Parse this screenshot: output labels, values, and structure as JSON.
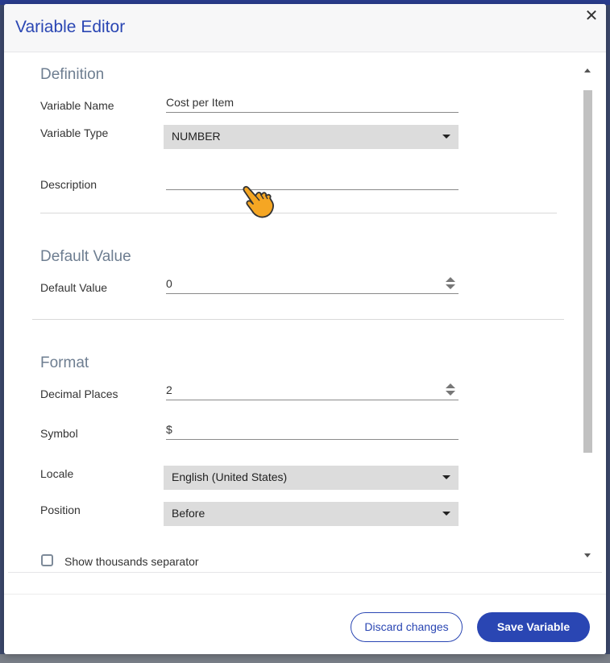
{
  "dialog": {
    "title": "Variable Editor",
    "close_glyph": "✕"
  },
  "definition": {
    "section_title": "Definition",
    "variable_name_label": "Variable Name",
    "variable_name_value": "Cost per Item",
    "variable_type_label": "Variable Type",
    "variable_type_value": "NUMBER",
    "description_label": "Description",
    "description_value": ""
  },
  "default_value": {
    "section_title": "Default Value",
    "label": "Default Value",
    "value": "0"
  },
  "format": {
    "section_title": "Format",
    "decimal_places_label": "Decimal Places",
    "decimal_places_value": "2",
    "symbol_label": "Symbol",
    "symbol_value": "$",
    "locale_label": "Locale",
    "locale_value": "English (United States)",
    "position_label": "Position",
    "position_value": "Before",
    "thousands_separator_label": "Show thousands separator",
    "thousands_separator_checked": false
  },
  "footer": {
    "discard_label": "Discard changes",
    "save_label": "Save Variable"
  },
  "colors": {
    "accent": "#2a46b3",
    "section_title": "#6e7e91",
    "select_bg": "#dcdcdc"
  },
  "icons": {
    "close": "close-icon",
    "dropdown": "caret-down-icon",
    "spinner": "spinner-arrows-icon",
    "cursor": "pointing-hand-cursor-icon"
  }
}
